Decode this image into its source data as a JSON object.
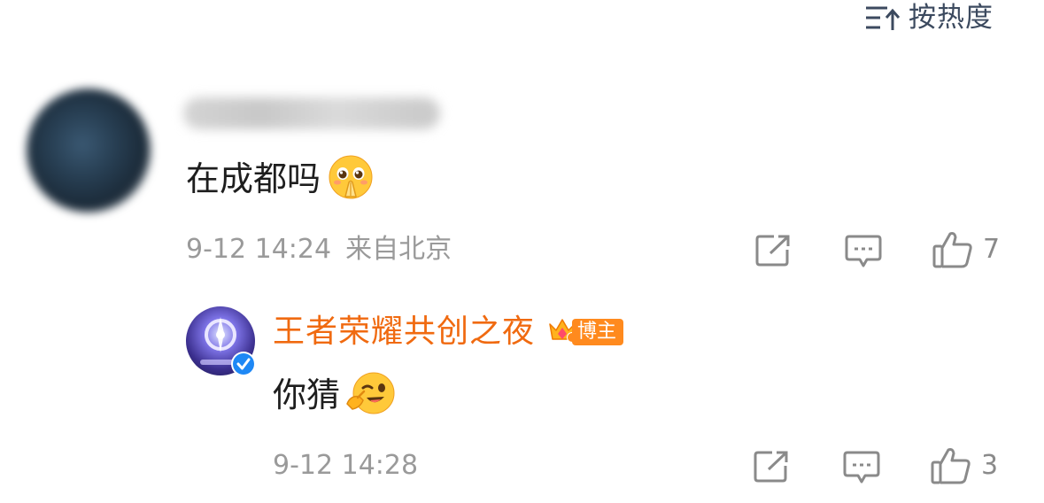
{
  "sort": {
    "label": "按热度",
    "icon": "sort-icon"
  },
  "comment": {
    "text": "在成都吗",
    "emoji": "pleading-hands-emoji",
    "time": "9-12 14:24",
    "location": "来自北京",
    "like_count": "7"
  },
  "reply": {
    "author": "王者荣耀共创之夜",
    "badge_label": "博主",
    "text": "你猜",
    "emoji": "wink-point-emoji",
    "time": "9-12 14:28",
    "like_count": "3"
  },
  "colors": {
    "accent_orange": "#f06a10",
    "badge_orange": "#ff8a1e",
    "verified_blue": "#1e88f5",
    "meta_gray": "#9a9a9a"
  }
}
